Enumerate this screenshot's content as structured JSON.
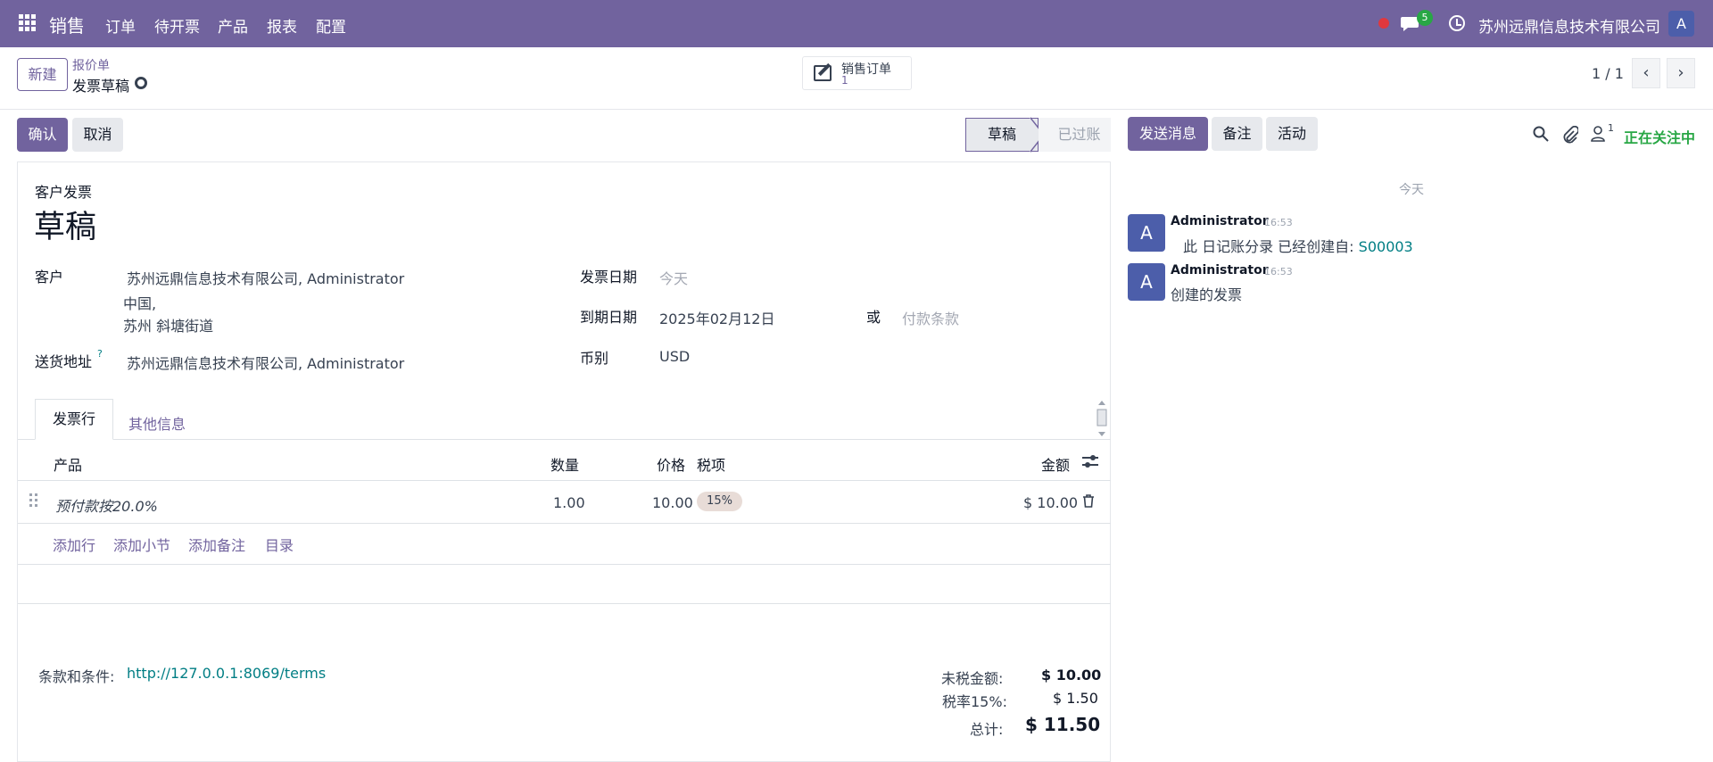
{
  "topbar": {
    "brand": "销售",
    "menus": [
      "订单",
      "待开票",
      "产品",
      "报表",
      "配置"
    ],
    "chat_badge": "5",
    "company": "苏州远鼎信息技术有限公司",
    "avatar": "A",
    "color": "#71639e"
  },
  "control_panel": {
    "new_button": "新建",
    "breadcrumb_parent": "报价单",
    "breadcrumb_current": "发票草稿",
    "smart_button": {
      "label": "销售订单",
      "count": "1"
    },
    "pager": "1 / 1"
  },
  "status_bar": {
    "confirm": "确认",
    "cancel": "取消",
    "stages": [
      "草稿",
      "已过账"
    ]
  },
  "form": {
    "type_label": "客户发票",
    "title": "草稿",
    "customer_label": "客户",
    "customer_value": "苏州远鼎信息技术有限公司, Administrator",
    "customer_addr1": "中国,",
    "customer_addr2": "苏州 斜塘街道",
    "delivery_label": "送货地址",
    "delivery_help": "?",
    "delivery_value": "苏州远鼎信息技术有限公司, Administrator",
    "invoice_date_label": "发票日期",
    "invoice_date_placeholder": "今天",
    "due_date_label": "到期日期",
    "due_date_value": "2025年02月12日",
    "or_label": "或",
    "payment_terms_placeholder": "付款条款",
    "currency_label": "币别",
    "currency_value": "USD"
  },
  "tabs": [
    "发票行",
    "其他信息"
  ],
  "lines": {
    "headers": {
      "product": "产品",
      "qty": "数量",
      "price": "价格",
      "taxes": "税项",
      "amount": "金额"
    },
    "rows": [
      {
        "product": "预付款按20.0%",
        "qty": "1.00",
        "price": "10.00",
        "tax": "15%",
        "amount": "$ 10.00"
      }
    ],
    "actions": [
      "添加行",
      "添加小节",
      "添加备注",
      "目录"
    ]
  },
  "terms": {
    "label": "条款和条件:",
    "link": "http://127.0.0.1:8069/terms"
  },
  "totals": {
    "untaxed_label": "未税金额:",
    "untaxed_value": "$ 10.00",
    "tax_label": "税率15%:",
    "tax_value": "$ 1.50",
    "total_label": "总计:",
    "total_value": "$ 11.50"
  },
  "chatter": {
    "send_message": "发送消息",
    "log_note": "备注",
    "activity": "活动",
    "followers_count": "1",
    "following": "正在关注中",
    "date_separator": "今天",
    "messages": [
      {
        "avatar": "A",
        "author": "Administrator",
        "time": "16:53",
        "body": "此 日记账分录 已经创建自:",
        "link": "S00003"
      },
      {
        "avatar": "A",
        "author": "Administrator",
        "time": "16:53",
        "body": "创建的发票"
      }
    ]
  }
}
